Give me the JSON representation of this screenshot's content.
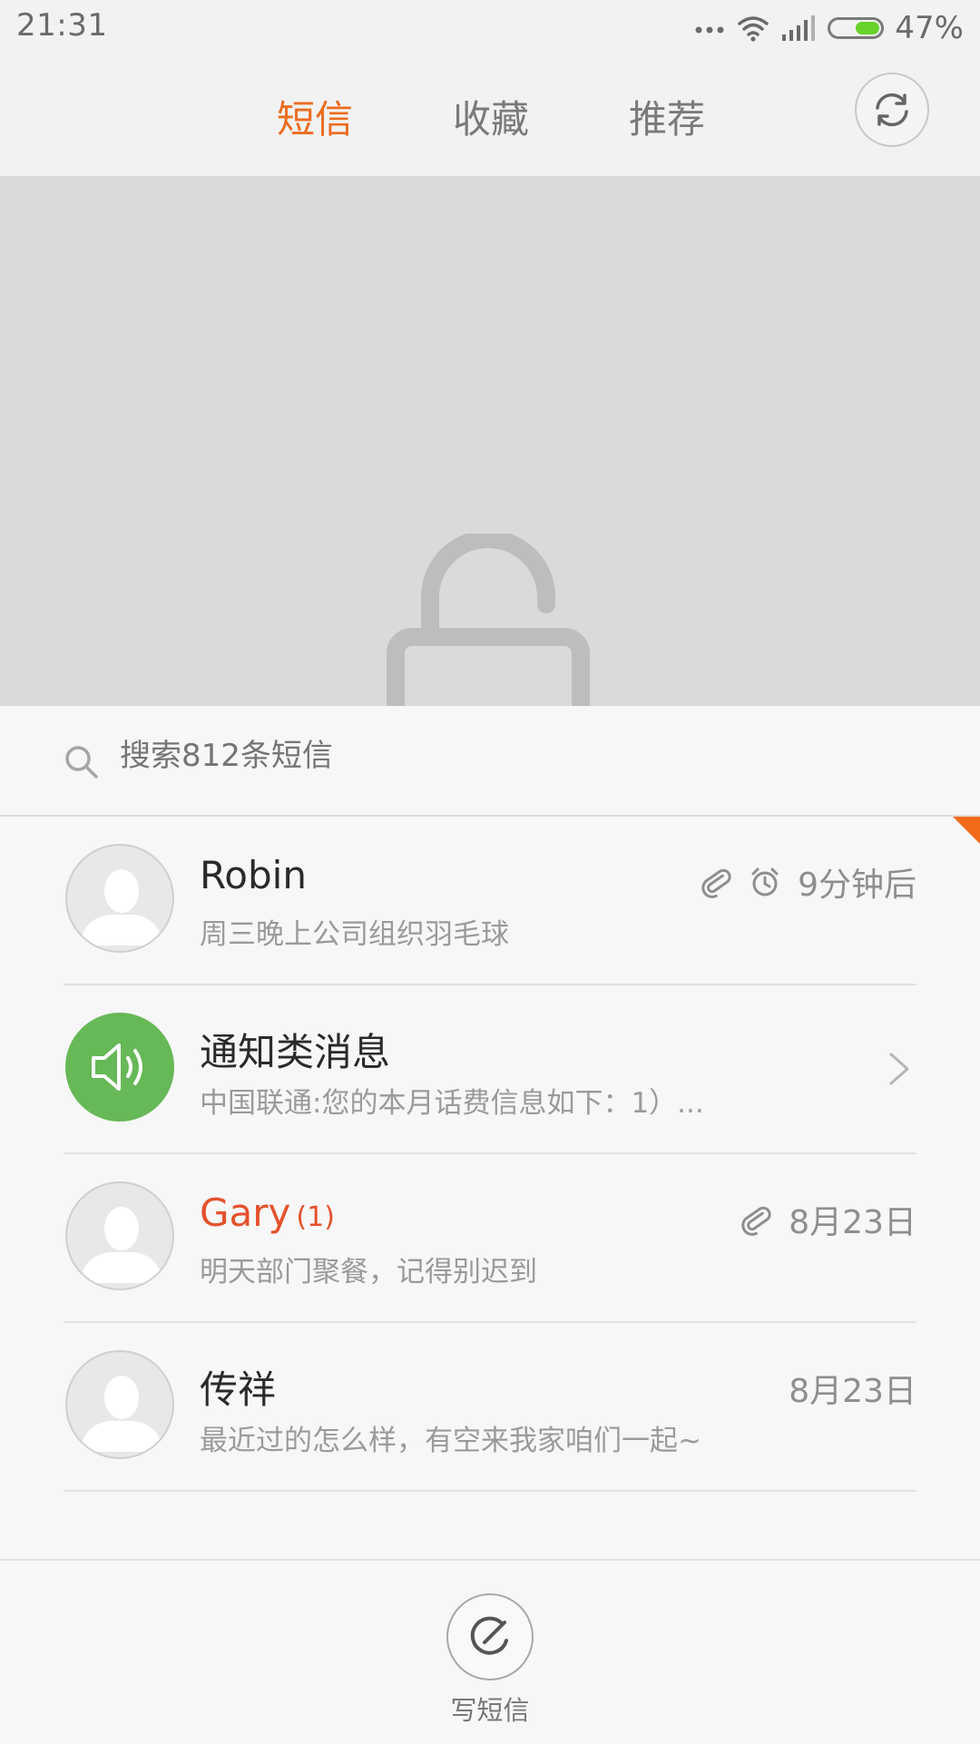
{
  "status_bar": {
    "time": "21:31",
    "battery_percent": "47%",
    "battery_level": 0.47,
    "icons": [
      "more-dots-icon",
      "wifi-icon",
      "signal-icon",
      "battery-icon"
    ],
    "battery_color": "#66d22b"
  },
  "header": {
    "tabs": [
      {
        "label": "短信",
        "active": true
      },
      {
        "label": "收藏",
        "active": false
      },
      {
        "label": "推荐",
        "active": false
      }
    ],
    "accent_color": "#ec6c1f",
    "sync_icon": "sync-icon"
  },
  "lock_area": {
    "icon": "unlock-icon",
    "background": "#dadada"
  },
  "search": {
    "placeholder": "搜索812条短信",
    "icon": "search-icon"
  },
  "messages": [
    {
      "name": "Robin",
      "preview": "周三晚上公司组织羽毛球",
      "time": "9分钟后",
      "has_attachment": true,
      "has_alarm": true,
      "avatar": "default-avatar"
    },
    {
      "name": "通知类消息",
      "preview": "中国联通:您的本月话费信息如下：1）...",
      "avatar": "speaker-icon",
      "avatar_color": "#67b857",
      "chevron": true
    },
    {
      "name": "Gary",
      "unread_count": "(1)",
      "preview": "明天部门聚餐，记得别迟到",
      "time": "8月23日",
      "has_attachment": true,
      "unread": true,
      "name_color": "#e5512c"
    },
    {
      "name": "传祥",
      "preview": "最近过的怎么样，有空来我家咱们一起~",
      "time": "8月23日"
    }
  ],
  "compose": {
    "label": "写短信",
    "icon": "compose-icon"
  }
}
